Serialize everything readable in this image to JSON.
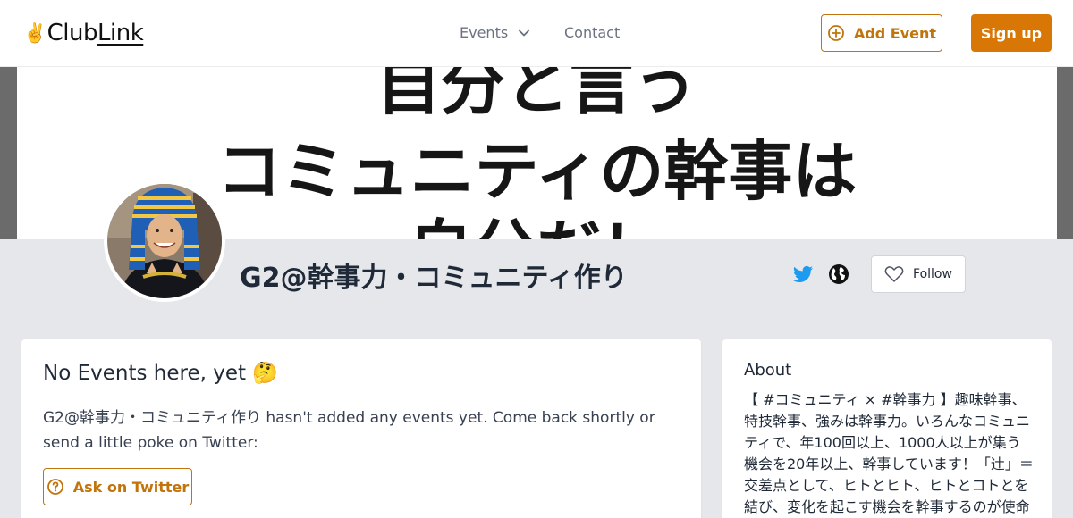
{
  "header": {
    "logo_hand": "✌️",
    "logo_club": "Club",
    "logo_link": "Link",
    "nav_events": "Events",
    "nav_contact": "Contact",
    "add_event_label": "Add Event",
    "signup_label": "Sign up"
  },
  "banner": {
    "line1": "自分と言う",
    "line2": "コミュニティの幹事は",
    "line3": "自分だ！"
  },
  "profile": {
    "name": "G2@幹事力・コミュニティ作り",
    "follow_label": "Follow"
  },
  "events": {
    "title": "No Events here, yet 🤔",
    "message": "G2@幹事力・コミュニティ作り hasn't added any events yet. Come back shortly or send a little poke on Twitter:",
    "ask_label": "Ask on Twitter"
  },
  "about": {
    "title": "About",
    "text": "【 #コミュニティ × #幹事力 】趣味幹事、特技幹事、強みは幹事力。いろんなコミュニティで、年100回以上、1000人以上が集う機会を20年以上、幹事しています！「辻」＝交差点として、ヒトとヒト、ヒトとコトとを結び、変化を起こす機会を幹事するのが使命"
  },
  "colors": {
    "accent": "#d97706",
    "accent_border": "#c2740c",
    "twitter": "#1d9bf0",
    "background": "#e5e7eb"
  }
}
